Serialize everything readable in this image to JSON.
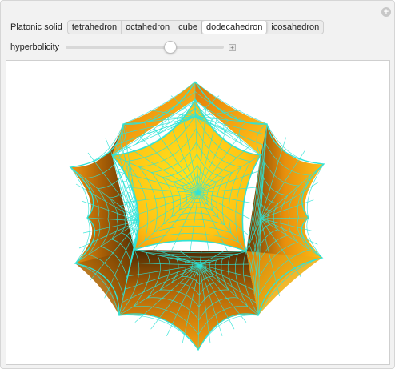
{
  "controls": {
    "platonic_label": "Platonic solid",
    "solids": [
      "tetrahedron",
      "octahedron",
      "cube",
      "dodecahedron",
      "icosahedron"
    ],
    "selected": "dodecahedron",
    "hyperbolicity_label": "hyperbolicity",
    "hyperbolicity_value": 0.66
  },
  "colors": {
    "mesh": "#2fe3d6",
    "face_light": "#ffd21a",
    "face_mid": "#f6a410",
    "face_dark": "#5a3004"
  }
}
